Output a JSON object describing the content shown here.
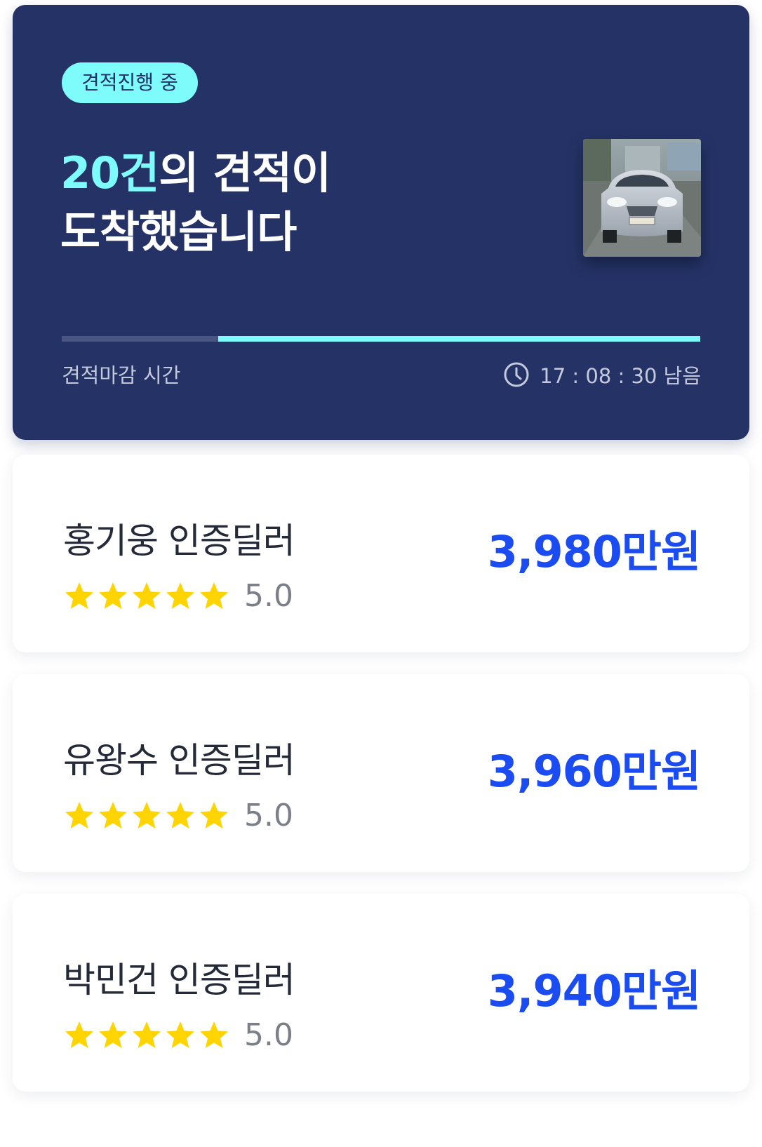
{
  "status_badge": "견적진행 중",
  "headline": {
    "count": "20건",
    "line1_rest": "의 견적이",
    "line2": "도착했습니다"
  },
  "progress": {
    "fraction_remaining": 0.755
  },
  "deadline": {
    "label": "견적마감 시간",
    "timer": "17 : 08 : 30 남음",
    "icon": "clock-icon"
  },
  "colors": {
    "hero_background": "#243266",
    "accent": "#7efcfb",
    "price": "#1a4cf2",
    "star": "#ffd400"
  },
  "offers": [
    {
      "dealer": "홍기웅 인증딜러",
      "rating": "5.0",
      "stars": 5,
      "price": "3,980만원"
    },
    {
      "dealer": "유왕수 인증딜러",
      "rating": "5.0",
      "stars": 5,
      "price": "3,960만원"
    },
    {
      "dealer": "박민건 인증딜러",
      "rating": "5.0",
      "stars": 5,
      "price": "3,940만원"
    }
  ]
}
